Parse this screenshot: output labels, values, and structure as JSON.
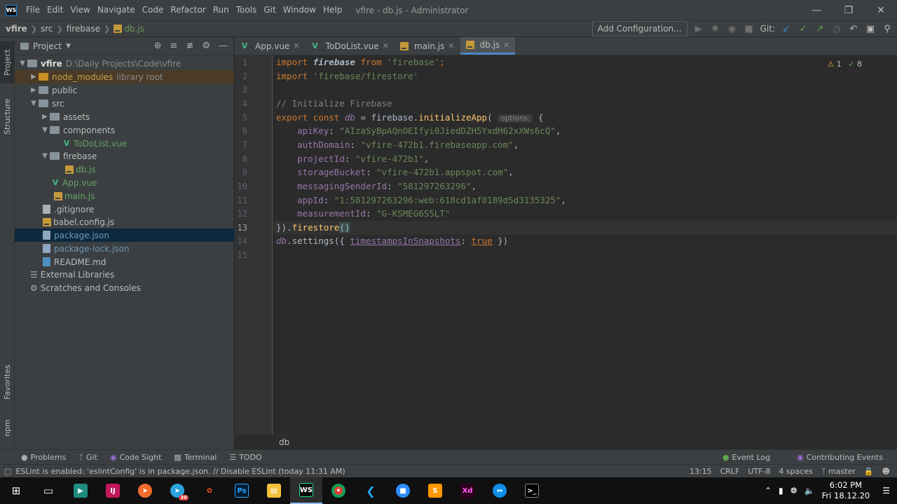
{
  "window": {
    "title": "vfire - db.js - Administrator",
    "app_icon": "WS"
  },
  "menu": [
    "File",
    "Edit",
    "View",
    "Navigate",
    "Code",
    "Refactor",
    "Run",
    "Tools",
    "Git",
    "Window",
    "Help"
  ],
  "breadcrumb": [
    "vfire",
    "src",
    "firebase",
    "db.js"
  ],
  "toolbar": {
    "add_config": "Add Configuration...",
    "git_label": "Git:"
  },
  "left_strip": {
    "project": "Project",
    "structure": "Structure",
    "favorites": "Favorites",
    "npm": "npm"
  },
  "project_panel": {
    "title": "Project",
    "tree": [
      {
        "name": "vfire",
        "note": "D:\\Daily Projects\\Code\\vfire",
        "bold": true
      },
      {
        "name": "node_modules",
        "note": "library root"
      },
      {
        "name": "public"
      },
      {
        "name": "src"
      },
      {
        "name": "assets"
      },
      {
        "name": "components"
      },
      {
        "name": "ToDoList.vue"
      },
      {
        "name": "firebase"
      },
      {
        "name": "db.js"
      },
      {
        "name": "App.vue"
      },
      {
        "name": "main.js"
      },
      {
        "name": ".gitignore"
      },
      {
        "name": "babel.config.js"
      },
      {
        "name": "package.json"
      },
      {
        "name": "package-lock.json"
      },
      {
        "name": "README.md"
      },
      {
        "name": "External Libraries"
      },
      {
        "name": "Scratches and Consoles"
      }
    ]
  },
  "tabs": [
    "App.vue",
    "ToDoList.vue",
    "main.js",
    "db.js"
  ],
  "editor": {
    "line_numbers": [
      "1",
      "2",
      "3",
      "4",
      "5",
      "6",
      "7",
      "8",
      "9",
      "10",
      "11",
      "12",
      "13",
      "14",
      "15"
    ],
    "current_line": "13",
    "warnings": {
      "warn_count": "1",
      "ok_count": "8"
    },
    "lines": {
      "l1": {
        "k1": "import",
        "v1": "firebase",
        "k2": "from",
        "s1": "'firebase'",
        "p": ";"
      },
      "l2": {
        "k1": "import",
        "s1": "'firebase/firestore'"
      },
      "l4": {
        "c": "// Initialize Firebase"
      },
      "l5": {
        "k1": "export",
        "k2": "const",
        "v": "db",
        "eq": " = ",
        "obj": "firebase.",
        "fn": "initializeApp",
        "paren": "(",
        "hint": "options:",
        "brace": " {"
      },
      "l6": {
        "key": "apiKey",
        "val": "\"AIzaSyBpAQnOEIfyi0JiedDZH5YxdH62xXWs6cQ\""
      },
      "l7": {
        "key": "authDomain",
        "val": "\"vfire-472b1.firebaseapp.com\""
      },
      "l8": {
        "key": "projectId",
        "val": "\"vfire-472b1\""
      },
      "l9": {
        "key": "storageBucket",
        "val": "\"vfire-472b1.appspot.com\""
      },
      "l10": {
        "key": "messagingSenderId",
        "val": "\"581297263296\""
      },
      "l11": {
        "key": "appId",
        "val": "\"1:581297263296:web:618cd1af0189d5d3135325\""
      },
      "l12": {
        "key": "measurementId",
        "val": "\"G-KSMEG6S5LT\""
      },
      "l13": {
        "close": "}).",
        "fn": "firestore",
        "parens": "()"
      },
      "l14": {
        "obj": "db",
        "dot": ".settings(",
        "brace": "{ ",
        "prop": "timestampsInSnapshots",
        "colon": ": ",
        "kw": "true",
        "end": " })"
      }
    }
  },
  "editor_breadcrumb": "db",
  "bottom_tools": {
    "problems": "Problems",
    "git": "Git",
    "codesight": "Code Sight",
    "terminal": "Terminal",
    "todo": "TODO",
    "eventlog": "Event Log",
    "contributing": "Contributing Events"
  },
  "status": {
    "message": "ESLint is enabled: 'eslintConfig' is in package.json. // Disable ESLint (today 11:31 AM)",
    "pos": "13:15",
    "eol": "CRLF",
    "enc": "UTF-8",
    "indent": "4 spaces",
    "branch": "master"
  },
  "taskbar": {
    "time": "6:02 PM",
    "date": "Fri 18.12.20",
    "badge": "30"
  }
}
